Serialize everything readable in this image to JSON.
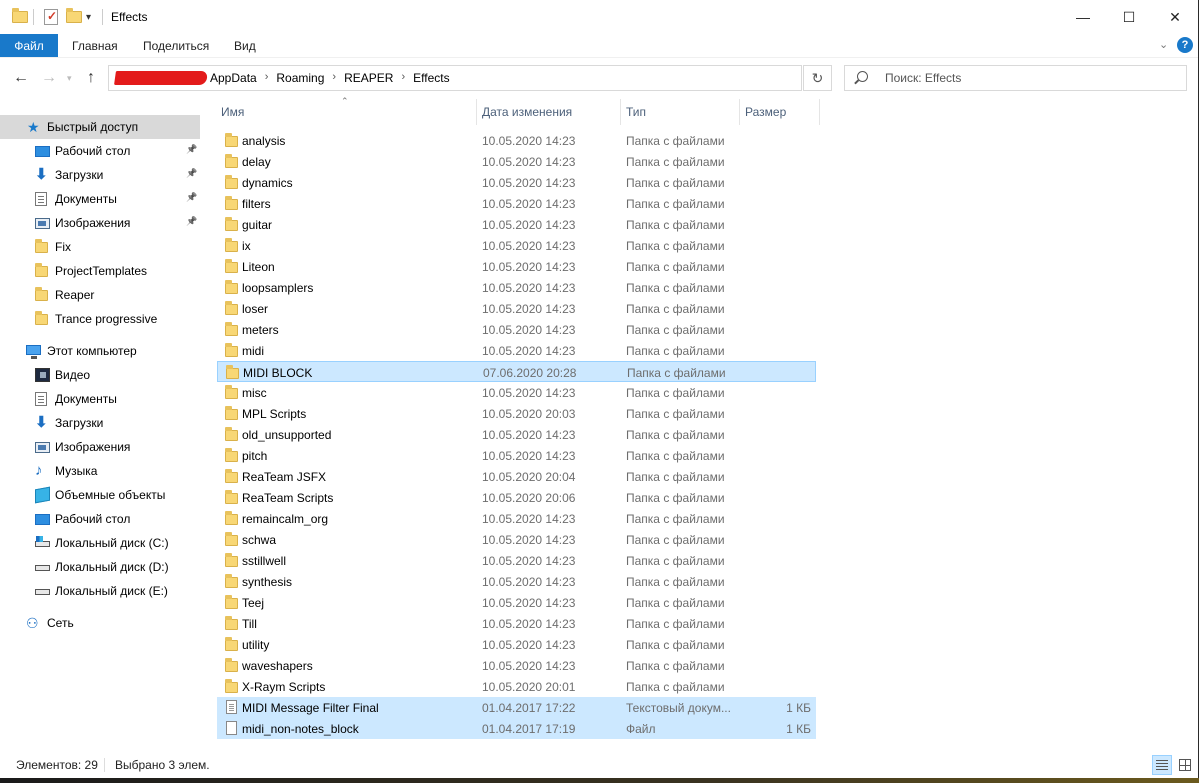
{
  "window": {
    "title": "Effects",
    "minimize_glyph": "—",
    "maximize_glyph": "☐",
    "close_glyph": "✕"
  },
  "ribbon": {
    "tabs": [
      "Файл",
      "Главная",
      "Поделиться",
      "Вид"
    ],
    "expand_glyph": "⌄",
    "help_glyph": "?"
  },
  "address": {
    "crumbs": [
      "AppData",
      "Roaming",
      "REAPER",
      "Effects"
    ],
    "separator": "›"
  },
  "search": {
    "placeholder": "Поиск: Effects"
  },
  "sidebar": {
    "quick_access": {
      "label": "Быстрый доступ",
      "items": [
        {
          "label": "Рабочий стол",
          "icon": "desktop-icon",
          "pinned": true
        },
        {
          "label": "Загрузки",
          "icon": "downloads-icon",
          "pinned": true
        },
        {
          "label": "Документы",
          "icon": "documents-icon",
          "pinned": true
        },
        {
          "label": "Изображения",
          "icon": "pictures-icon",
          "pinned": true
        },
        {
          "label": "Fix",
          "icon": "folder-icon",
          "pinned": false
        },
        {
          "label": "ProjectTemplates",
          "icon": "folder-icon",
          "pinned": false
        },
        {
          "label": "Reaper",
          "icon": "folder-icon",
          "pinned": false
        },
        {
          "label": "Trance progressive",
          "icon": "folder-icon",
          "pinned": false
        }
      ]
    },
    "this_pc": {
      "label": "Этот компьютер",
      "items": [
        {
          "label": "Видео",
          "icon": "video-icon"
        },
        {
          "label": "Документы",
          "icon": "documents-icon"
        },
        {
          "label": "Загрузки",
          "icon": "downloads-icon"
        },
        {
          "label": "Изображения",
          "icon": "pictures-icon"
        },
        {
          "label": "Музыка",
          "icon": "music-icon"
        },
        {
          "label": "Объемные объекты",
          "icon": "3d-objects-icon"
        },
        {
          "label": "Рабочий стол",
          "icon": "desktop-icon"
        },
        {
          "label": "Локальный диск (C:)",
          "icon": "system-drive-icon"
        },
        {
          "label": "Локальный диск (D:)",
          "icon": "drive-icon"
        },
        {
          "label": "Локальный диск (E:)",
          "icon": "drive-icon"
        }
      ]
    },
    "network": {
      "label": "Сеть",
      "icon": "network-icon"
    }
  },
  "columns": {
    "name": "Имя",
    "date": "Дата изменения",
    "type": "Тип",
    "size": "Размер"
  },
  "files": [
    {
      "name": "analysis",
      "date": "10.05.2020 14:23",
      "type": "Папка с файлами",
      "size": "",
      "kind": "folder",
      "selected": false
    },
    {
      "name": "delay",
      "date": "10.05.2020 14:23",
      "type": "Папка с файлами",
      "size": "",
      "kind": "folder",
      "selected": false
    },
    {
      "name": "dynamics",
      "date": "10.05.2020 14:23",
      "type": "Папка с файлами",
      "size": "",
      "kind": "folder",
      "selected": false
    },
    {
      "name": "filters",
      "date": "10.05.2020 14:23",
      "type": "Папка с файлами",
      "size": "",
      "kind": "folder",
      "selected": false
    },
    {
      "name": "guitar",
      "date": "10.05.2020 14:23",
      "type": "Папка с файлами",
      "size": "",
      "kind": "folder",
      "selected": false
    },
    {
      "name": "ix",
      "date": "10.05.2020 14:23",
      "type": "Папка с файлами",
      "size": "",
      "kind": "folder",
      "selected": false
    },
    {
      "name": "Liteon",
      "date": "10.05.2020 14:23",
      "type": "Папка с файлами",
      "size": "",
      "kind": "folder",
      "selected": false
    },
    {
      "name": "loopsamplers",
      "date": "10.05.2020 14:23",
      "type": "Папка с файлами",
      "size": "",
      "kind": "folder",
      "selected": false
    },
    {
      "name": "loser",
      "date": "10.05.2020 14:23",
      "type": "Папка с файлами",
      "size": "",
      "kind": "folder",
      "selected": false
    },
    {
      "name": "meters",
      "date": "10.05.2020 14:23",
      "type": "Папка с файлами",
      "size": "",
      "kind": "folder",
      "selected": false
    },
    {
      "name": "midi",
      "date": "10.05.2020 14:23",
      "type": "Папка с файлами",
      "size": "",
      "kind": "folder",
      "selected": false
    },
    {
      "name": "MIDI BLOCK",
      "date": "07.06.2020 20:28",
      "type": "Папка с файлами",
      "size": "",
      "kind": "folder",
      "selected": true
    },
    {
      "name": "misc",
      "date": "10.05.2020 14:23",
      "type": "Папка с файлами",
      "size": "",
      "kind": "folder",
      "selected": false
    },
    {
      "name": "MPL Scripts",
      "date": "10.05.2020 20:03",
      "type": "Папка с файлами",
      "size": "",
      "kind": "folder",
      "selected": false
    },
    {
      "name": "old_unsupported",
      "date": "10.05.2020 14:23",
      "type": "Папка с файлами",
      "size": "",
      "kind": "folder",
      "selected": false
    },
    {
      "name": "pitch",
      "date": "10.05.2020 14:23",
      "type": "Папка с файлами",
      "size": "",
      "kind": "folder",
      "selected": false
    },
    {
      "name": "ReaTeam JSFX",
      "date": "10.05.2020 20:04",
      "type": "Папка с файлами",
      "size": "",
      "kind": "folder",
      "selected": false
    },
    {
      "name": "ReaTeam Scripts",
      "date": "10.05.2020 20:06",
      "type": "Папка с файлами",
      "size": "",
      "kind": "folder",
      "selected": false
    },
    {
      "name": "remaincalm_org",
      "date": "10.05.2020 14:23",
      "type": "Папка с файлами",
      "size": "",
      "kind": "folder",
      "selected": false
    },
    {
      "name": "schwa",
      "date": "10.05.2020 14:23",
      "type": "Папка с файлами",
      "size": "",
      "kind": "folder",
      "selected": false
    },
    {
      "name": "sstillwell",
      "date": "10.05.2020 14:23",
      "type": "Папка с файлами",
      "size": "",
      "kind": "folder",
      "selected": false
    },
    {
      "name": "synthesis",
      "date": "10.05.2020 14:23",
      "type": "Папка с файлами",
      "size": "",
      "kind": "folder",
      "selected": false
    },
    {
      "name": "Teej",
      "date": "10.05.2020 14:23",
      "type": "Папка с файлами",
      "size": "",
      "kind": "folder",
      "selected": false
    },
    {
      "name": "Till",
      "date": "10.05.2020 14:23",
      "type": "Папка с файлами",
      "size": "",
      "kind": "folder",
      "selected": false
    },
    {
      "name": "utility",
      "date": "10.05.2020 14:23",
      "type": "Папка с файлами",
      "size": "",
      "kind": "folder",
      "selected": false
    },
    {
      "name": "waveshapers",
      "date": "10.05.2020 14:23",
      "type": "Папка с файлами",
      "size": "",
      "kind": "folder",
      "selected": false
    },
    {
      "name": "X-Raym Scripts",
      "date": "10.05.2020 20:01",
      "type": "Папка с файлами",
      "size": "",
      "kind": "folder",
      "selected": false
    },
    {
      "name": "MIDI Message Filter Final",
      "date": "01.04.2017 17:22",
      "type": "Текстовый докум...",
      "size": "1 КБ",
      "kind": "text",
      "selected": true
    },
    {
      "name": "midi_non-notes_block",
      "date": "01.04.2017 17:19",
      "type": "Файл",
      "size": "1 КБ",
      "kind": "file",
      "selected": true
    }
  ],
  "status": {
    "count": "Элементов: 29",
    "selected": "Выбрано 3 элем."
  },
  "colors": {
    "accent": "#1979ca",
    "selection": "#cce8ff",
    "selection_border": "#99d1ff",
    "folder": "#f8d775",
    "redaction": "#e31b1b"
  }
}
